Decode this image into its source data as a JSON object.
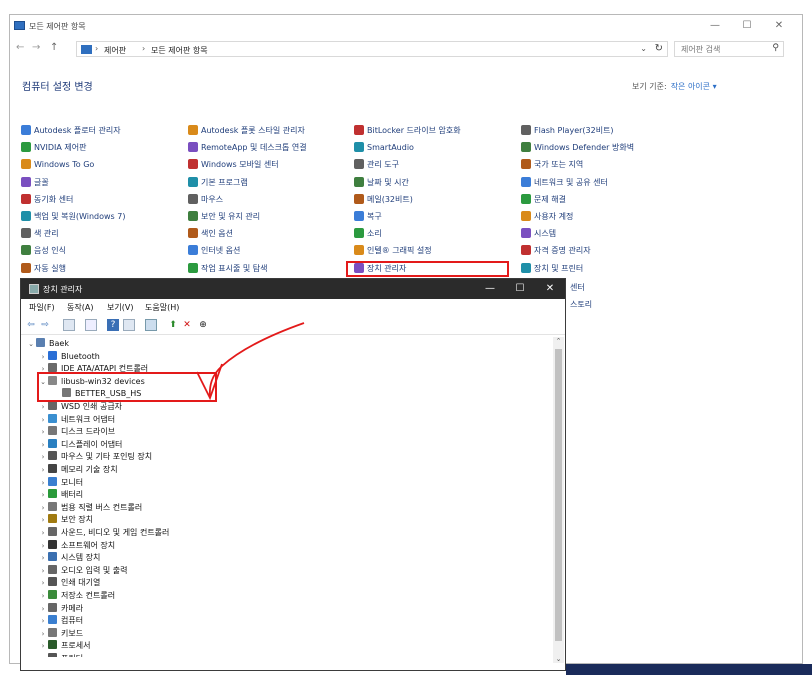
{
  "cp": {
    "title": "모든 제어판 항목",
    "minimize": "—",
    "maximize": "☐",
    "close": "✕",
    "nav_back": "←",
    "nav_forward": "→",
    "nav_up": "↑",
    "breadcrumb": [
      "제어판",
      "모든 제어판 항목"
    ],
    "breadcrumb_sep": "›",
    "search_placeholder": "제어판 검색",
    "page_title": "컴퓨터 설정 변경",
    "view_by_label": "보기 기준:",
    "view_by_value": "작은 아이콘 ▾",
    "columns": [
      [
        "Autodesk 플로터 관리자",
        "NVIDIA 제어판",
        "Windows To Go",
        "글꼴",
        "동기화 센터",
        "백업 및 복원(Windows 7)",
        "색 관리",
        "음성 인식",
        "자동 실행"
      ],
      [
        "Autodesk 플롯 스타일 관리자",
        "RemoteApp 및 데스크톱 연결",
        "Windows 모바일 센터",
        "기본 프로그램",
        "마우스",
        "보안 및 유지 관리",
        "색인 옵션",
        "인터넷 옵션",
        "작업 표시줄 및 탐색"
      ],
      [
        "BitLocker 드라이브 암호화",
        "SmartAudio",
        "관리 도구",
        "날짜 및 시간",
        "메일(32비트)",
        "복구",
        "소리",
        "인텔® 그래픽 설정",
        "장치 관리자"
      ],
      [
        "Flash Player(32비트)",
        "Windows Defender 방화벽",
        "국가 또는 지역",
        "네트워크 및 공유 센터",
        "문제 해결",
        "사용자 계정",
        "시스템",
        "자격 증명 관리자",
        "장치 및 프린터"
      ]
    ],
    "partial_items": [
      "센터",
      "스토리"
    ]
  },
  "dm": {
    "title": "장치 관리자",
    "minimize": "—",
    "maximize": "☐",
    "close": "✕",
    "menu": [
      "파일(F)",
      "동작(A)",
      "보기(V)",
      "도움말(H)"
    ],
    "root": "Baek",
    "tree": [
      {
        "label": "Bluetooth",
        "expanded": false
      },
      {
        "label": "IDE ATA/ATAPI 컨트롤러",
        "expanded": false
      },
      {
        "label": "libusb-win32 devices",
        "expanded": true,
        "child": "BETTER_USB_HS"
      },
      {
        "label": "WSD 인쇄 공급자",
        "expanded": false
      },
      {
        "label": "네트워크 어댑터",
        "expanded": false
      },
      {
        "label": "디스크 드라이브",
        "expanded": false
      },
      {
        "label": "디스플레이 어댑터",
        "expanded": false
      },
      {
        "label": "마우스 및 기타 포인팅 장치",
        "expanded": false
      },
      {
        "label": "메모리 기술 장치",
        "expanded": false
      },
      {
        "label": "모니터",
        "expanded": false
      },
      {
        "label": "배터리",
        "expanded": false
      },
      {
        "label": "범용 직렬 버스 컨트롤러",
        "expanded": false
      },
      {
        "label": "보안 장치",
        "expanded": false
      },
      {
        "label": "사운드, 비디오 및 게임 컨트롤러",
        "expanded": false
      },
      {
        "label": "소프트웨어 장치",
        "expanded": false
      },
      {
        "label": "시스템 장치",
        "expanded": false
      },
      {
        "label": "오디오 입력 및 출력",
        "expanded": false
      },
      {
        "label": "인쇄 대기열",
        "expanded": false
      },
      {
        "label": "저장소 컨트롤러",
        "expanded": false
      },
      {
        "label": "카메라",
        "expanded": false
      },
      {
        "label": "컴퓨터",
        "expanded": false
      },
      {
        "label": "키보드",
        "expanded": false
      },
      {
        "label": "프로세서",
        "expanded": false
      },
      {
        "label": "프린터",
        "expanded": false
      }
    ]
  },
  "colors": {
    "annotation": "#e31a1a",
    "link": "#1f3d7a",
    "titlebar_dark": "#2b2b2b"
  }
}
